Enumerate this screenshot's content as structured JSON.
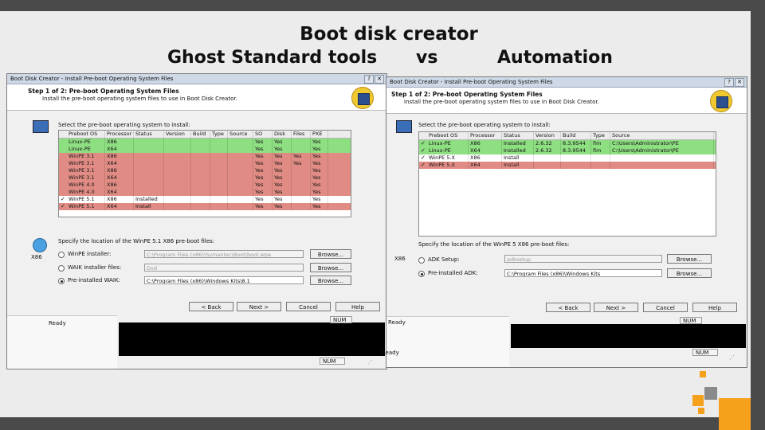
{
  "slide": {
    "title_line1": "Boot disk creator",
    "left_label": "Ghost Standard tools",
    "middle_label": "vs",
    "right_label": "Automation"
  },
  "left_window": {
    "title": "Boot Disk Creator - Install Pre-boot Operating System Files",
    "step_title": "Step 1 of 2: Pre-boot Operating System Files",
    "step_desc": "Install the pre-boot operating system files to use in Boot Disk Creator.",
    "select_label": "Select the pre-boot operating system to install:",
    "columns": [
      "Preboot OS",
      "Processor",
      "Status",
      "Version",
      "Build",
      "Type",
      "Source",
      "SO",
      "Disk",
      "Files",
      "PXE"
    ],
    "rows": [
      {
        "check": "",
        "cells": [
          "Linux-PE",
          "X86",
          "",
          "",
          "",
          "",
          "",
          "Yes",
          "Yes",
          "",
          "Yes"
        ],
        "color": "green"
      },
      {
        "check": "",
        "cells": [
          "Linux-PE",
          "X64",
          "",
          "",
          "",
          "",
          "",
          "Yes",
          "Yes",
          "",
          "Yes"
        ],
        "color": "green"
      },
      {
        "check": "",
        "cells": [
          "WinPE 3.1",
          "X86",
          "",
          "",
          "",
          "",
          "",
          "Yes",
          "Yes",
          "Yes",
          "Yes"
        ],
        "color": "red"
      },
      {
        "check": "",
        "cells": [
          "WinPE 3.1",
          "X64",
          "",
          "",
          "",
          "",
          "",
          "Yes",
          "Yes",
          "Yes",
          "Yes"
        ],
        "color": "red"
      },
      {
        "check": "",
        "cells": [
          "WinPE 3.1",
          "X86",
          "",
          "",
          "",
          "",
          "",
          "Yes",
          "Yes",
          "",
          "Yes"
        ],
        "color": "red"
      },
      {
        "check": "",
        "cells": [
          "WinPE 3.1",
          "X64",
          "",
          "",
          "",
          "",
          "",
          "Yes",
          "Yes",
          "",
          "Yes"
        ],
        "color": "red"
      },
      {
        "check": "",
        "cells": [
          "WinPE 4.0",
          "X86",
          "",
          "",
          "",
          "",
          "",
          "Yes",
          "Yes",
          "",
          "Yes"
        ],
        "color": "red"
      },
      {
        "check": "",
        "cells": [
          "WinPE 4.0",
          "X64",
          "",
          "",
          "",
          "",
          "",
          "Yes",
          "Yes",
          "",
          "Yes"
        ],
        "color": "red"
      },
      {
        "check": "✓",
        "cells": [
          "WinPE 5.1",
          "X86",
          "Installed",
          "",
          "",
          "",
          "",
          "Yes",
          "Yes",
          "",
          "Yes"
        ],
        "color": "white"
      },
      {
        "check": "✓",
        "cells": [
          "WinPE 5.1",
          "X64",
          "Install",
          "",
          "",
          "",
          "",
          "Yes",
          "Yes",
          "",
          "Yes"
        ],
        "color": "red"
      }
    ],
    "location_label": "Specify the location of the WinPE 5.1 X86 pre-boot files:",
    "arch_label": "X86",
    "options": [
      {
        "label": "WinPE installer:",
        "value": "C:\\Program Files (x86)\\Symantec\\Boot\\boot.wpe",
        "selected": false
      },
      {
        "label": "WAIK installer files:",
        "value": "Dvd",
        "selected": false
      },
      {
        "label": "Pre-installed WAIK:",
        "value": "C:\\Program Files (x86)\\Windows Kits\\8.1",
        "selected": true
      }
    ],
    "browse_label": "Browse...",
    "back_label": "< Back",
    "next_label": "Next >",
    "cancel_label": "Cancel",
    "help_label": "Help",
    "status_ready": "Ready",
    "status_num": "NUM"
  },
  "right_window": {
    "title": "Boot Disk Creator - Install Pre-boot Operating System Files",
    "step_title": "Step 1 of 2: Pre-boot Operating System Files",
    "step_desc": "Install the pre-boot operating system files to use in Boot Disk Creator.",
    "select_label": "Select the pre-boot operating system to install:",
    "columns": [
      "Preboot OS",
      "Processor",
      "Status",
      "Version",
      "Build",
      "Type",
      "Source"
    ],
    "rows": [
      {
        "check": "✓",
        "cells": [
          "Linux-PE",
          "X86",
          "Installed",
          "2.6.32",
          "8.3.9544",
          "fim",
          "C:\\Users\\Administrator\\PE"
        ],
        "color": "green"
      },
      {
        "check": "✓",
        "cells": [
          "Linux-PE",
          "X64",
          "Installed",
          "2.6.32",
          "8.3.9544",
          "fim",
          "C:\\Users\\Administrator\\PE"
        ],
        "color": "green"
      },
      {
        "check": "✓",
        "cells": [
          "WinPE 5.X",
          "X86",
          "Install",
          "",
          "",
          "",
          ""
        ],
        "color": "white"
      },
      {
        "check": "✓",
        "cells": [
          "WinPE 5.X",
          "X64",
          "Install",
          "",
          "",
          "",
          ""
        ],
        "color": "red"
      }
    ],
    "location_label": "Specify the location of the WinPE 5 X86 pre-boot files:",
    "arch_label": "X86",
    "options": [
      {
        "label": "ADK Setup:",
        "value": "adksetup",
        "selected": false
      },
      {
        "label": "Pre-installed ADK:",
        "value": "C:\\Program Files (x86)\\Windows Kits",
        "selected": true
      }
    ],
    "browse_label": "Browse...",
    "back_label": "< Back",
    "next_label": "Next >",
    "cancel_label": "Cancel",
    "help_label": "Help",
    "status_ready": "Ready",
    "status_num": "NUM"
  },
  "colors": {
    "green_row": "#8ede82",
    "red_row": "#e08c84",
    "accent_square": "#f5a11c",
    "grey_square": "#8a8a8a"
  }
}
